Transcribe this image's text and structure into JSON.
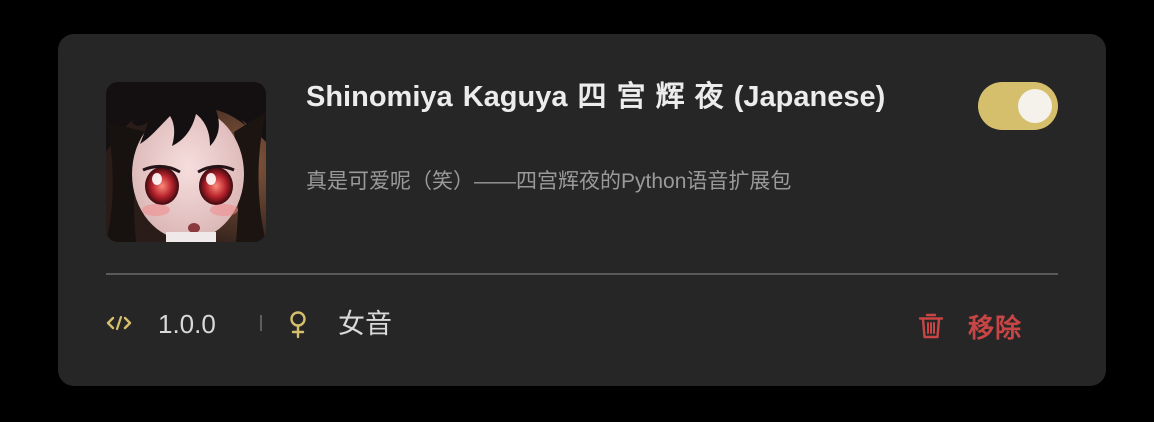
{
  "plugin": {
    "title": "Shinomiya Kaguya 四 宫 辉 夜 (Japanese)",
    "description": "真是可爱呢（笑）——四宫辉夜的Python语音扩展包",
    "enabled": true,
    "version": "1.0.0",
    "gender": "女音",
    "remove_label": "移除"
  },
  "icons": {
    "version": "code-icon",
    "gender": "female-icon",
    "remove": "trash-icon"
  },
  "colors": {
    "accent": "#d6bf6c",
    "danger": "#c74545",
    "card_bg": "#262626",
    "page_bg": "#000000"
  }
}
